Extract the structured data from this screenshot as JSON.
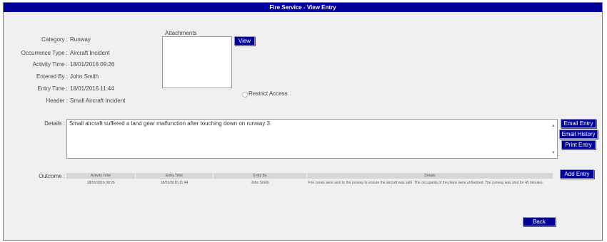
{
  "title": "Fire Service - View Entry",
  "fields": [
    {
      "label": "Category :",
      "value": "Runway"
    },
    {
      "label": "Occurrence Type :",
      "value": "Aircraft Incident"
    },
    {
      "label": "Activity Time :",
      "value": "18/01/2016 09:26"
    },
    {
      "label": "Entered By :",
      "value": "John Smith"
    },
    {
      "label": "Entry Time :",
      "value": "18/01/2016 11:44"
    },
    {
      "label": "Header :",
      "value": "Small Aircraft Incident"
    }
  ],
  "attachments": {
    "title": "Attachments",
    "view_label": "View"
  },
  "restrict_access_label": "Restrict Access",
  "details": {
    "label": "Details :",
    "text": "Small aircraft suffered a land gear malfunction after touching down on runway 3."
  },
  "actions": {
    "email_entry": "Email Entry",
    "email_history": "Email History",
    "print_entry": "Print Entry",
    "add_entry": "Add Entry",
    "back": "Back"
  },
  "outcome": {
    "label": "Outcome :",
    "columns": [
      "Activity Time",
      "Entry Time",
      "Entry By",
      "Details"
    ],
    "rows": [
      {
        "activity_time": "18/01/2016 09:26",
        "entry_time": "18/01/2016 11:44",
        "entry_by": "John Smith",
        "details": "Fire crews were sent to the runway to ensure the aircraft was safe. The occupants of the plane were unharmed. The runway was shut for 45 minutes."
      }
    ]
  },
  "colors": {
    "title_bar": "#000099",
    "button": "#000099",
    "background": "#f0f0f0"
  }
}
